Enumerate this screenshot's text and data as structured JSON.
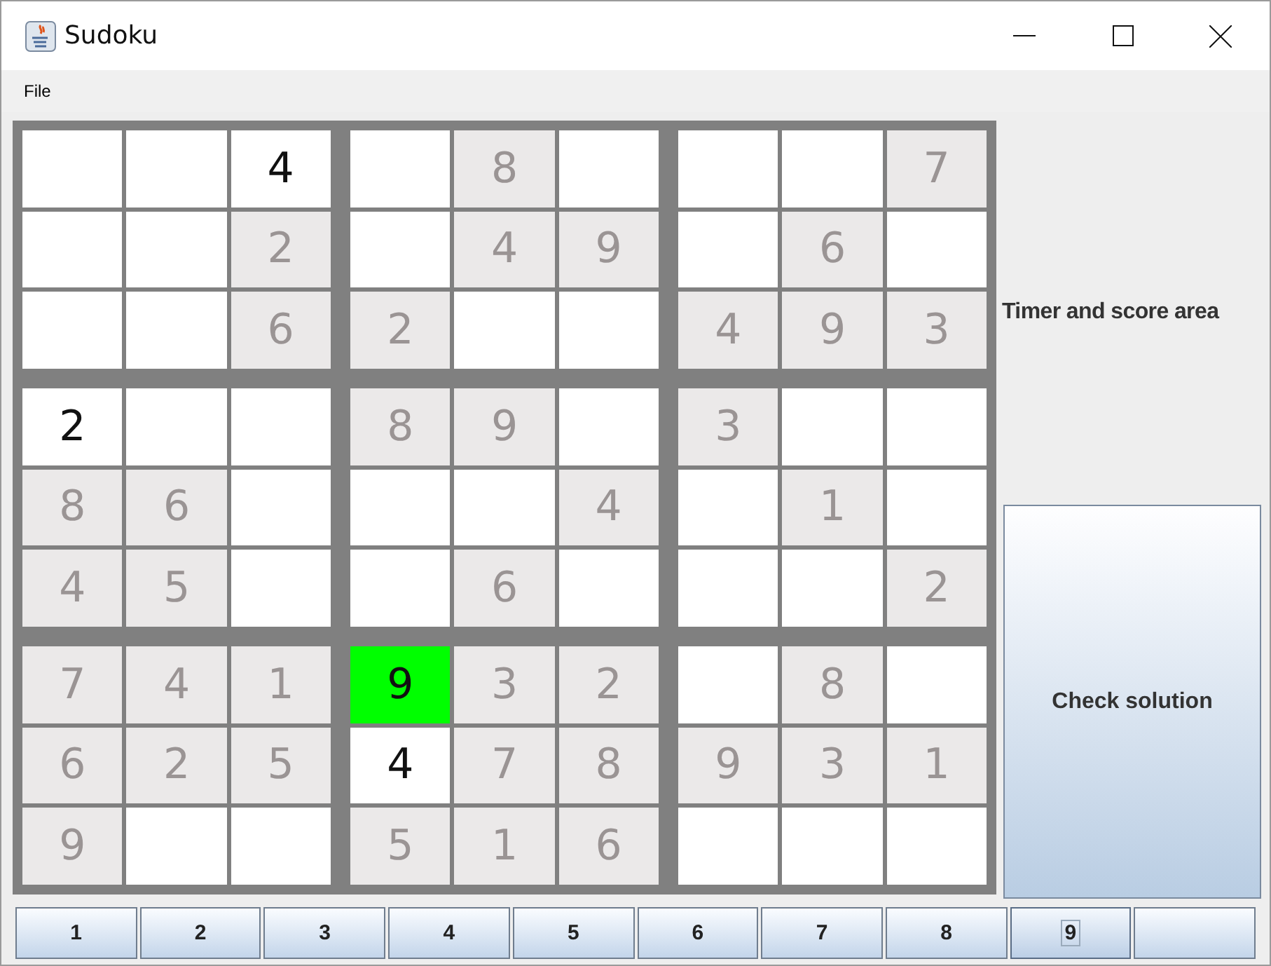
{
  "window": {
    "title": "Sudoku"
  },
  "menu": [
    {
      "label": "File"
    }
  ],
  "board": {
    "rows": [
      [
        {
          "kind": "empty",
          "selected": false
        },
        {
          "kind": "empty",
          "selected": false
        },
        {
          "kind": "entered",
          "value": "4",
          "selected": false
        },
        {
          "kind": "empty",
          "selected": false
        },
        {
          "kind": "given",
          "value": "8",
          "selected": false
        },
        {
          "kind": "empty",
          "selected": false
        },
        {
          "kind": "empty",
          "selected": false
        },
        {
          "kind": "empty",
          "selected": false
        },
        {
          "kind": "given",
          "value": "7",
          "selected": false
        }
      ],
      [
        {
          "kind": "empty",
          "selected": false
        },
        {
          "kind": "empty",
          "selected": false
        },
        {
          "kind": "given",
          "value": "2",
          "selected": false
        },
        {
          "kind": "empty",
          "selected": false
        },
        {
          "kind": "given",
          "value": "4",
          "selected": false
        },
        {
          "kind": "given",
          "value": "9",
          "selected": false
        },
        {
          "kind": "empty",
          "selected": false
        },
        {
          "kind": "given",
          "value": "6",
          "selected": false
        },
        {
          "kind": "empty",
          "selected": false
        }
      ],
      [
        {
          "kind": "empty",
          "selected": false
        },
        {
          "kind": "empty",
          "selected": false
        },
        {
          "kind": "given",
          "value": "6",
          "selected": false
        },
        {
          "kind": "given",
          "value": "2",
          "selected": false
        },
        {
          "kind": "empty",
          "selected": false
        },
        {
          "kind": "empty",
          "selected": false
        },
        {
          "kind": "given",
          "value": "4",
          "selected": false
        },
        {
          "kind": "given",
          "value": "9",
          "selected": false
        },
        {
          "kind": "given",
          "value": "3",
          "selected": false
        }
      ],
      [
        {
          "kind": "entered",
          "value": "2",
          "selected": false
        },
        {
          "kind": "empty",
          "selected": false
        },
        {
          "kind": "empty",
          "selected": false
        },
        {
          "kind": "given",
          "value": "8",
          "selected": false
        },
        {
          "kind": "given",
          "value": "9",
          "selected": false
        },
        {
          "kind": "empty",
          "selected": false
        },
        {
          "kind": "given",
          "value": "3",
          "selected": false
        },
        {
          "kind": "empty",
          "selected": false
        },
        {
          "kind": "empty",
          "selected": false
        }
      ],
      [
        {
          "kind": "given",
          "value": "8",
          "selected": false
        },
        {
          "kind": "given",
          "value": "6",
          "selected": false
        },
        {
          "kind": "empty",
          "selected": false
        },
        {
          "kind": "empty",
          "selected": false
        },
        {
          "kind": "empty",
          "selected": false
        },
        {
          "kind": "given",
          "value": "4",
          "selected": false
        },
        {
          "kind": "empty",
          "selected": false
        },
        {
          "kind": "given",
          "value": "1",
          "selected": false
        },
        {
          "kind": "empty",
          "selected": false
        }
      ],
      [
        {
          "kind": "given",
          "value": "4",
          "selected": false
        },
        {
          "kind": "given",
          "value": "5",
          "selected": false
        },
        {
          "kind": "empty",
          "selected": false
        },
        {
          "kind": "empty",
          "selected": false
        },
        {
          "kind": "given",
          "value": "6",
          "selected": false
        },
        {
          "kind": "empty",
          "selected": false
        },
        {
          "kind": "empty",
          "selected": false
        },
        {
          "kind": "empty",
          "selected": false
        },
        {
          "kind": "given",
          "value": "2",
          "selected": false
        }
      ],
      [
        {
          "kind": "given",
          "value": "7",
          "selected": false
        },
        {
          "kind": "given",
          "value": "4",
          "selected": false
        },
        {
          "kind": "given",
          "value": "1",
          "selected": false
        },
        {
          "kind": "entered",
          "value": "9",
          "selected": true
        },
        {
          "kind": "given",
          "value": "3",
          "selected": false
        },
        {
          "kind": "given",
          "value": "2",
          "selected": false
        },
        {
          "kind": "empty",
          "selected": false
        },
        {
          "kind": "given",
          "value": "8",
          "selected": false
        },
        {
          "kind": "empty",
          "selected": false
        }
      ],
      [
        {
          "kind": "given",
          "value": "6",
          "selected": false
        },
        {
          "kind": "given",
          "value": "2",
          "selected": false
        },
        {
          "kind": "given",
          "value": "5",
          "selected": false
        },
        {
          "kind": "entered",
          "value": "4",
          "selected": false
        },
        {
          "kind": "given",
          "value": "7",
          "selected": false
        },
        {
          "kind": "given",
          "value": "8",
          "selected": false
        },
        {
          "kind": "given",
          "value": "9",
          "selected": false
        },
        {
          "kind": "given",
          "value": "3",
          "selected": false
        },
        {
          "kind": "given",
          "value": "1",
          "selected": false
        }
      ],
      [
        {
          "kind": "given",
          "value": "9",
          "selected": false
        },
        {
          "kind": "empty",
          "selected": false
        },
        {
          "kind": "empty",
          "selected": false
        },
        {
          "kind": "given",
          "value": "5",
          "selected": false
        },
        {
          "kind": "given",
          "value": "1",
          "selected": false
        },
        {
          "kind": "given",
          "value": "6",
          "selected": false
        },
        {
          "kind": "empty",
          "selected": false
        },
        {
          "kind": "empty",
          "selected": false
        },
        {
          "kind": "empty",
          "selected": false
        }
      ]
    ]
  },
  "side_panel": {
    "label": "Timer and score area",
    "button": "Check solution"
  },
  "number_buttons": [
    {
      "label": "1",
      "focused": false
    },
    {
      "label": "2",
      "focused": false
    },
    {
      "label": "3",
      "focused": false
    },
    {
      "label": "4",
      "focused": false
    },
    {
      "label": "5",
      "focused": false
    },
    {
      "label": "6",
      "focused": false
    },
    {
      "label": "7",
      "focused": false
    },
    {
      "label": "8",
      "focused": false
    },
    {
      "label": "9",
      "focused": true
    },
    {
      "focused": false
    }
  ]
}
